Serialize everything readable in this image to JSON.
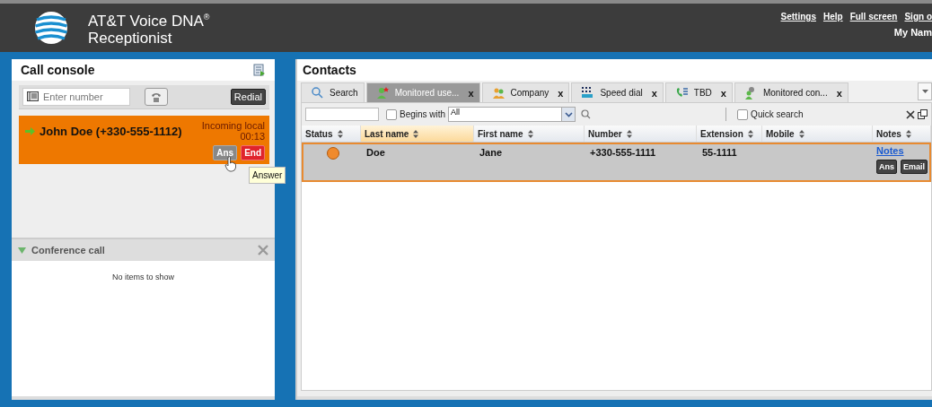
{
  "header": {
    "title": "AT&T Voice DNA$^{®}$",
    "subtitle": "Receptionist",
    "links": [
      "Settings",
      "Help",
      "Full screen",
      "Sign o"
    ],
    "user": "My Nam"
  },
  "call_console": {
    "title": "Call console",
    "number_field": {
      "placeholder": "Enter number"
    },
    "redial_button": "Redial",
    "calls": [
      {
        "name": "John Doe (+330-555-1112)",
        "status": "Incoming local",
        "timer": "00:13",
        "buttons": [
          {
            "label": "Ans",
            "kind": "answer",
            "hovered": true
          },
          {
            "label": "End",
            "kind": "end",
            "hovered": false
          }
        ]
      }
    ],
    "tooltip": "Answer",
    "conference": {
      "title": "Conference call",
      "expanded": true,
      "empty_text": "No items to show"
    }
  },
  "contacts": {
    "title": "Contacts",
    "tabs": [
      {
        "label": "Search",
        "kind": "search",
        "selected": false
      },
      {
        "label": "Monitored use...",
        "kind": "monitored",
        "close": "x",
        "selected": true
      },
      {
        "label": "Company",
        "kind": "company",
        "close": "x",
        "selected": false
      },
      {
        "label": "Speed dial",
        "kind": "speed",
        "close": "x",
        "selected": false
      },
      {
        "label": "TBD",
        "kind": "phone",
        "close": "x",
        "selected": false
      },
      {
        "label": "Monitored con...",
        "kind": "watch",
        "close": "x",
        "selected": false
      }
    ],
    "filter": {
      "begins_with": {
        "label": "Begins with",
        "checked": false
      },
      "scope": "All",
      "quick_search": {
        "label": "Quick search",
        "checked": false
      }
    },
    "columns": [
      {
        "label": "Status",
        "sorted": false
      },
      {
        "label": "Last name",
        "sorted": true
      },
      {
        "label": "First name",
        "sorted": false
      },
      {
        "label": "Number",
        "sorted": false
      },
      {
        "label": "Extension",
        "sorted": false
      },
      {
        "label": "Mobile",
        "sorted": false
      },
      {
        "label": "Notes",
        "sorted": false
      }
    ],
    "rows": [
      {
        "color": "#f08a2c",
        "last_name": "Doe",
        "first_name": "Jane",
        "number": "+330-555-1111",
        "extension": "55-1111",
        "notes_link": "Notes",
        "buttons": [
          "Ans",
          "Email"
        ],
        "selected": true
      }
    ]
  }
}
